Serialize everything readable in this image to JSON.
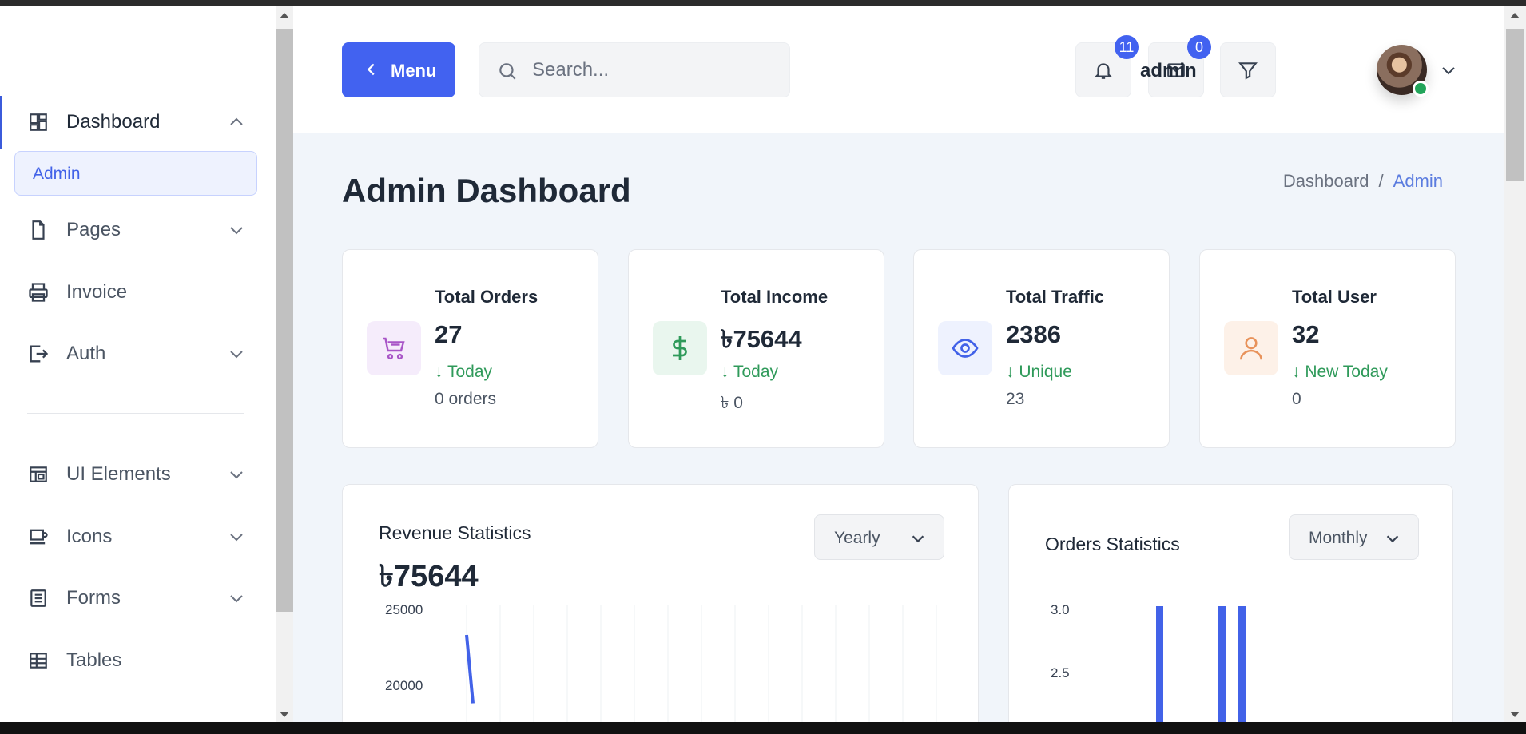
{
  "sidebar": {
    "items": [
      {
        "label": "Dashboard",
        "icon": "dashboard-icon",
        "expanded": true
      },
      {
        "label": "Pages",
        "icon": "page-icon"
      },
      {
        "label": "Invoice",
        "icon": "printer-icon"
      },
      {
        "label": "Auth",
        "icon": "login-icon"
      },
      {
        "label": "UI Elements",
        "icon": "layout-icon"
      },
      {
        "label": "Icons",
        "icon": "cup-icon"
      },
      {
        "label": "Forms",
        "icon": "form-icon"
      },
      {
        "label": "Tables",
        "icon": "table-icon"
      }
    ],
    "sub_admin": "Admin"
  },
  "header": {
    "menu_label": "Menu",
    "search_placeholder": "Search...",
    "notifications_count": "11",
    "messages_count": "0",
    "username": "admin"
  },
  "page": {
    "title": "Admin Dashboard",
    "breadcrumb": {
      "home": "Dashboard",
      "separator": "/",
      "current": "Admin"
    }
  },
  "cards": [
    {
      "title": "Total Orders",
      "value": "27",
      "delta": "↓ Today",
      "sub": "0 orders",
      "icon": "cart-icon",
      "color": "#a855c7",
      "bg": "#f5ecfb"
    },
    {
      "title": "Total Income",
      "value": "৳75644",
      "delta": "↓ Today",
      "sub": "৳ 0",
      "icon": "dollar-icon",
      "color": "#2f9a5a",
      "bg": "#e9f6ee"
    },
    {
      "title": "Total Traffic",
      "value": "2386",
      "delta": "↓ Unique",
      "sub": "23",
      "icon": "eye-icon",
      "color": "#4262e8",
      "bg": "#eef2fe"
    },
    {
      "title": "Total User",
      "value": "32",
      "delta": "↓ New Today",
      "sub": "0",
      "icon": "user-icon",
      "color": "#e8925a",
      "bg": "#fdf1e8"
    }
  ],
  "revenue": {
    "title": "Revenue Statistics",
    "value": "৳75644",
    "period": "Yearly",
    "chart_data": {
      "type": "line",
      "y_ticks": [
        "25000",
        "20000"
      ],
      "y_range_visible": [
        20000,
        25000
      ],
      "series": [
        {
          "values": [
            23000,
            18500
          ]
        }
      ]
    }
  },
  "orders": {
    "title": "Orders Statistics",
    "period": "Monthly",
    "chart_data": {
      "type": "bar",
      "y_ticks": [
        "3.0",
        "2.5"
      ],
      "y_range_visible": [
        2.5,
        3.0
      ],
      "series": [
        {
          "values": [
            3,
            3,
            3
          ]
        }
      ]
    }
  },
  "colors": {
    "accent": "#4262f0",
    "success": "#2f9a5a",
    "sidebar_active_bg": "#eef2fe"
  }
}
